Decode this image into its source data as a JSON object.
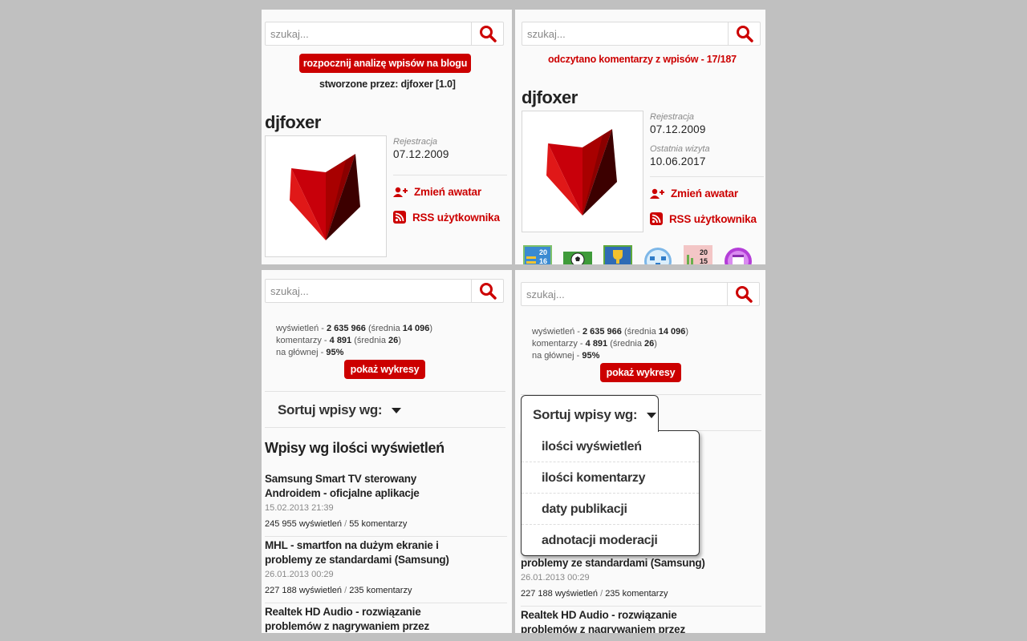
{
  "search": {
    "placeholder": "szukaj..."
  },
  "panel1": {
    "start_button": "rozpocznij analizę wpisów na blogu",
    "created_by": "stworzone przez: djfoxer [1.0]"
  },
  "panel2": {
    "status": "odczytano komentarzy z wpisów - 17/187"
  },
  "profile": {
    "username": "djfoxer",
    "registration_label": "Rejestracja",
    "registration_date": "07.12.2009",
    "last_visit_label": "Ostatnia wizyta",
    "last_visit_date": "10.06.2017",
    "change_avatar": "Zmień awatar",
    "rss": "RSS użytkownika",
    "badges": [
      "badge-2016-icon",
      "badge-football-icon",
      "badge-trophy-icon",
      "badge-network-icon",
      "badge-2015-icon",
      "badge-calendar-icon"
    ],
    "badge_texts": {
      "b2016_a": "20",
      "b2016_b": "16",
      "b2015_a": "20",
      "b2015_b": "15"
    }
  },
  "stats": {
    "views_label": "wyświetleń - ",
    "views_value": "2 635 966",
    "views_avg_open": " (średnia ",
    "views_avg": "14 096",
    "close": ")",
    "comments_label": "komentarzy - ",
    "comments_value": "4 891",
    "comments_avg_open": " (średnia ",
    "comments_avg": "26",
    "main_label": "na głównej - ",
    "main_value": "95%"
  },
  "charts_button": "pokaż wykresy",
  "sort": {
    "label": "Sortuj wpisy wg:",
    "options": [
      "ilości wyświetleń",
      "ilości komentarzy",
      "daty publikacji",
      "adnotacji moderacji"
    ]
  },
  "list_heading": "Wpisy wg ilości wyświetleń",
  "posts": [
    {
      "title": "Samsung Smart TV sterowany Androidem - oficjalne aplikacje",
      "date": "15.02.2013 21:39",
      "views": "245 955 wyświetleń",
      "sep": " / ",
      "comments": "55 komentarzy"
    },
    {
      "title": "MHL - smartfon na dużym ekranie i problemy ze standardami (Samsung)",
      "title_tail": "problemy ze standardami (Samsung)",
      "date": "26.01.2013 00:29",
      "views": "227 188 wyświetleń",
      "sep": " / ",
      "comments": "235 komentarzy"
    },
    {
      "title": "Realtek HD Audio - rozwiązanie problemów z nagrywaniem przez"
    }
  ],
  "colors": {
    "accent": "#cc0000",
    "background": "#c0c0c0",
    "panel": "#fafafa"
  }
}
